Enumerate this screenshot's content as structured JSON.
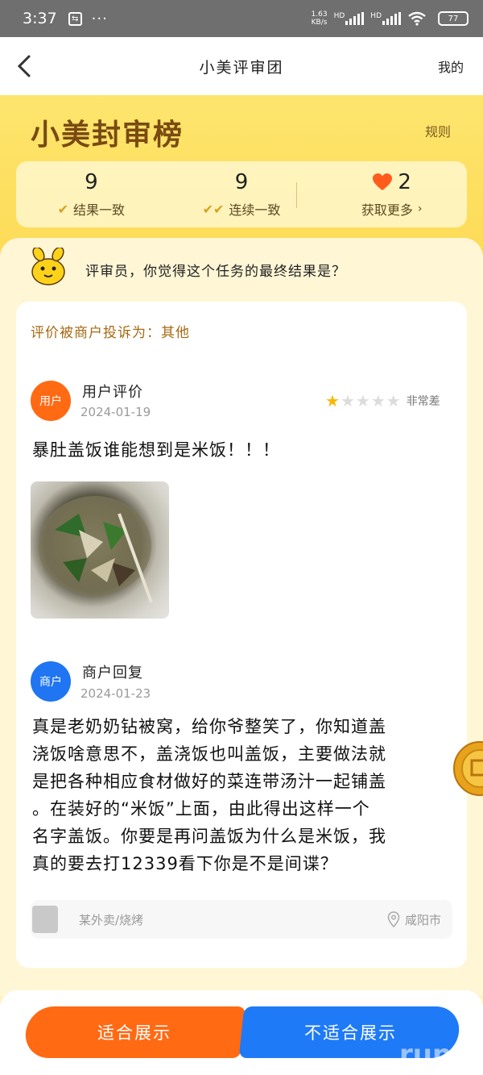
{
  "status_bar": {
    "time": "3:37",
    "net_speed": "1.63",
    "net_unit": "KB/s",
    "hd1": "HD",
    "hd2": "HD",
    "battery": "77"
  },
  "navbar": {
    "title": "小美评审团",
    "right": "我的"
  },
  "hero": {
    "title": "小美封审榜",
    "rules": "规则"
  },
  "stats": [
    {
      "value": "9",
      "label": "结果一致"
    },
    {
      "value": "9",
      "label": "连续一致"
    },
    {
      "value": "2",
      "label": "获取更多"
    }
  ],
  "question": "评审员，你觉得这个任务的最终结果是？",
  "complaint": "评价被商户投诉为：其他",
  "user_review": {
    "avatar_label": "用户",
    "name": "用户评价",
    "date": "2024-01-19",
    "rating": 1,
    "rating_max": 5,
    "rating_text": "非常差",
    "text": "暴肚盖饭谁能想到是米饭！！！"
  },
  "merchant_reply": {
    "avatar_label": "商户",
    "name": "商户回复",
    "date": "2024-01-23",
    "lines": [
      "真是老奶奶钻被窝，给你爷整笑了，你知道盖",
      "浇饭啥意思不，盖浇饭也叫盖饭，主要做法就",
      "是把各种相应食材做好的菜连带汤汁一起铺盖",
      "。在装好的“米饭”上面，由此得出这样一个",
      "名字盖饭。你要是再问盖饭为什么是米饭，我",
      "真的要去打12339看下你是不是间谍？"
    ]
  },
  "shop": {
    "name": "某外卖/烧烤",
    "location": "咸阳市"
  },
  "buttons": {
    "suitable": "适合展示",
    "unsuitable": "不适合展示"
  },
  "watermark": "run",
  "colors": {
    "accent_orange": "#ff6a13",
    "accent_blue": "#1f75f2",
    "hero_yellow": "#fdd548",
    "brand_brown": "#7a4a12"
  }
}
